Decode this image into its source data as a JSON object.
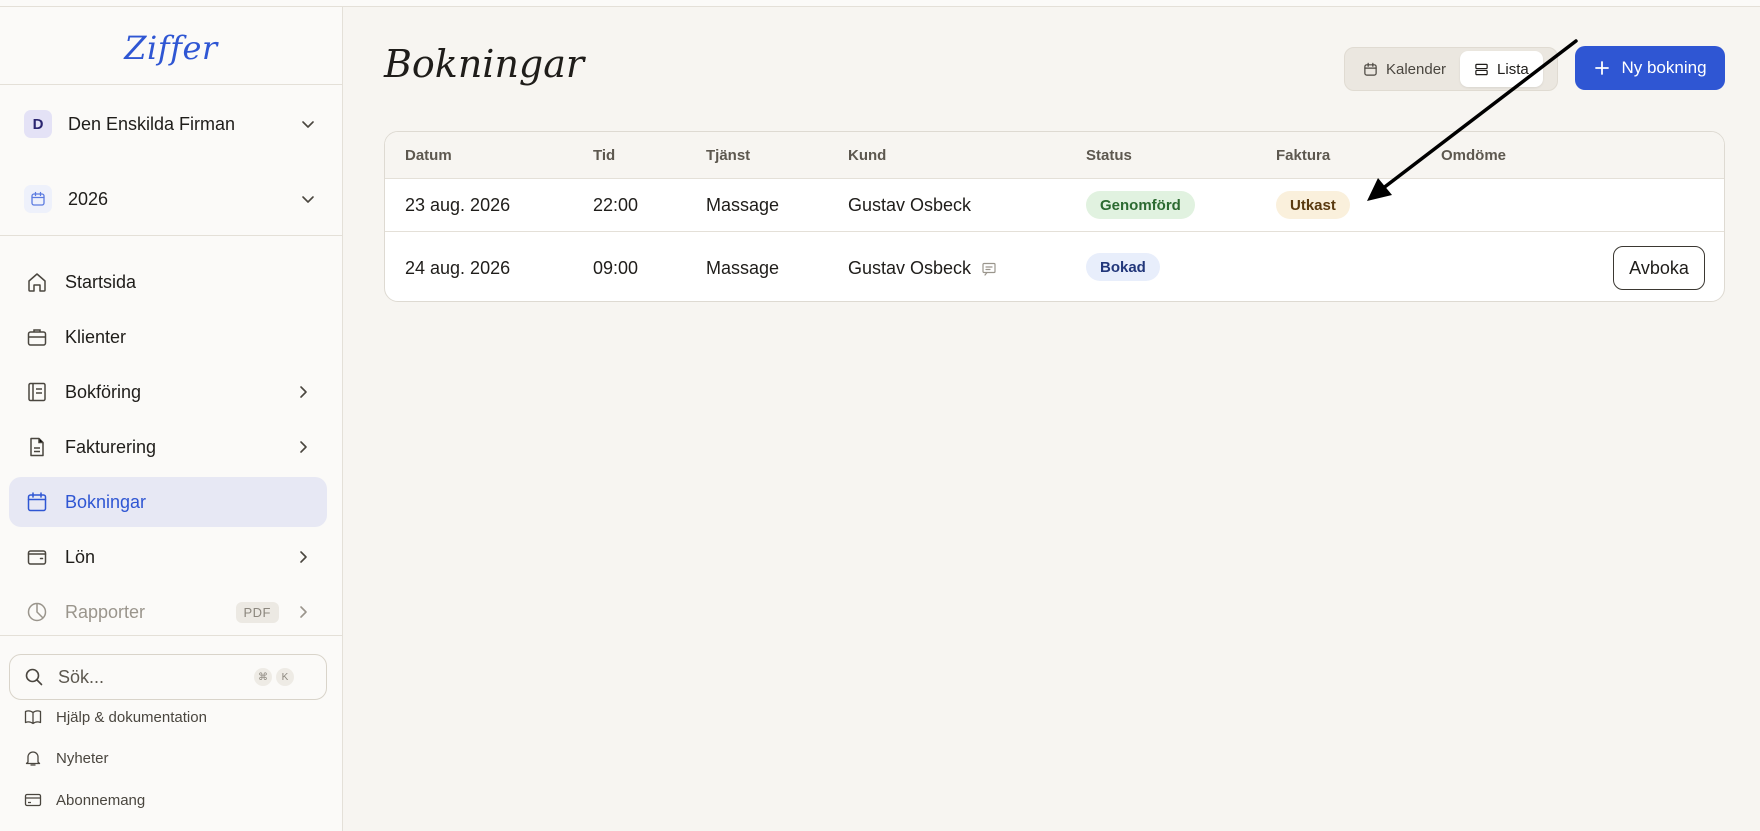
{
  "app": {
    "logo": "Ziffer"
  },
  "sidebar": {
    "company": {
      "initial": "D",
      "name": "Den Enskilda Firman"
    },
    "year": {
      "value": "2026"
    },
    "items": [
      {
        "label": "Startsida"
      },
      {
        "label": "Klienter"
      },
      {
        "label": "Bokföring"
      },
      {
        "label": "Fakturering"
      },
      {
        "label": "Bokningar"
      },
      {
        "label": "Lön"
      },
      {
        "label": "Rapporter",
        "badge": "PDF"
      }
    ],
    "search": {
      "placeholder": "Sök...",
      "shortcut": [
        "⌘",
        "K"
      ]
    },
    "footer": [
      {
        "label": "Hjälp & dokumentation"
      },
      {
        "label": "Nyheter"
      },
      {
        "label": "Abonnemang"
      }
    ]
  },
  "main": {
    "title": "Bokningar",
    "view_toggle": {
      "calendar": "Kalender",
      "list": "Lista"
    },
    "new_button": "Ny bokning",
    "table": {
      "headers": [
        "Datum",
        "Tid",
        "Tjänst",
        "Kund",
        "Status",
        "Faktura",
        "Omdöme"
      ],
      "rows": [
        {
          "date": "23 aug. 2026",
          "time": "22:00",
          "service": "Massage",
          "customer": "Gustav Osbeck",
          "status": "Genomförd",
          "invoice": "Utkast"
        },
        {
          "date": "24 aug. 2026",
          "time": "09:00",
          "service": "Massage",
          "customer": "Gustav Osbeck",
          "status": "Bokad",
          "action": "Avboka"
        }
      ]
    }
  },
  "colors": {
    "accent": "#2f56d3",
    "status_done": "#e1f2e0",
    "status_draft": "#faf0dc",
    "status_booked": "#e8eefb"
  }
}
